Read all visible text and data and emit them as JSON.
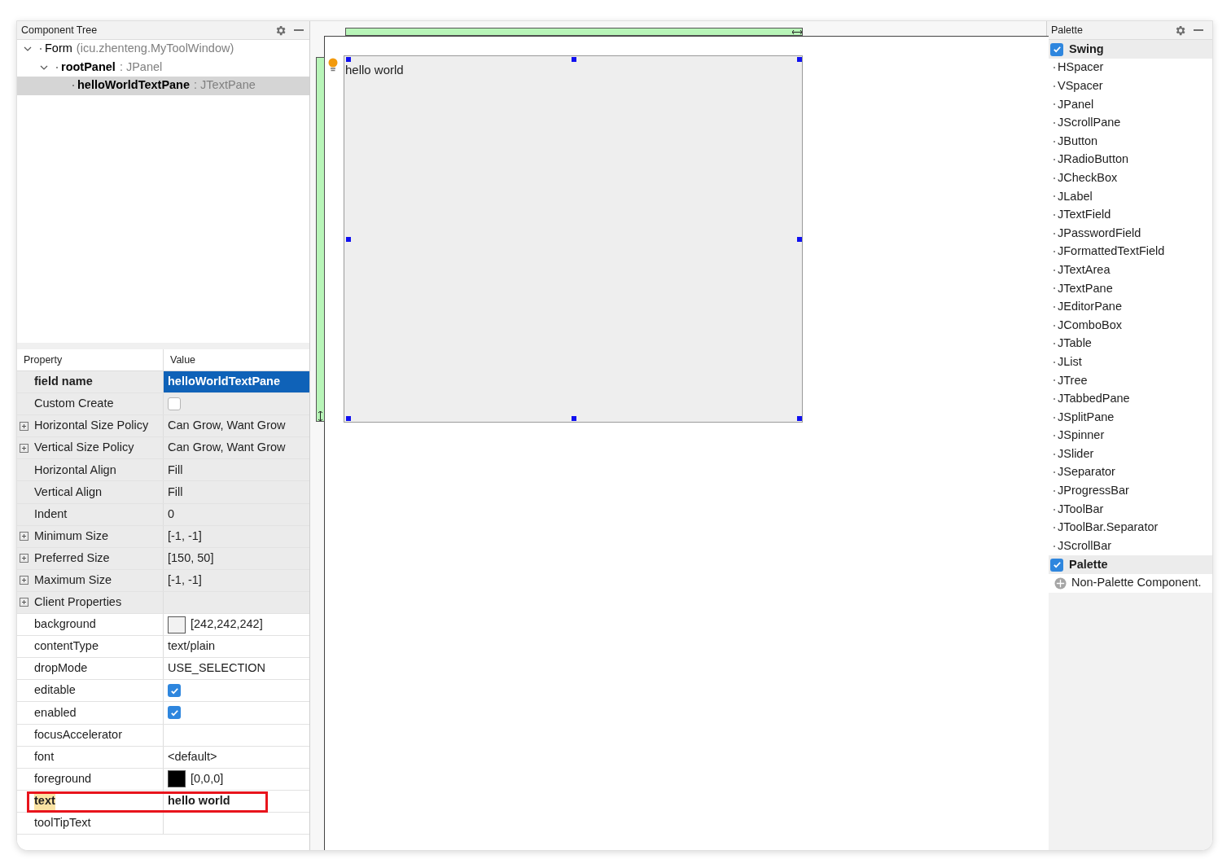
{
  "tree": {
    "title": "Component Tree",
    "items": [
      {
        "name": "Form",
        "type": "(icu.zhenteng.MyToolWindow)",
        "kind": "form",
        "expanded": true,
        "selected": false,
        "children": [
          {
            "name": "rootPanel",
            "type": ": JPanel",
            "kind": "component",
            "expanded": true,
            "selected": false,
            "children": [
              {
                "name": "helloWorldTextPane",
                "type": ": JTextPane",
                "kind": "component",
                "selected": true
              }
            ]
          }
        ]
      }
    ]
  },
  "properties": {
    "columns": [
      "Property",
      "Value"
    ],
    "rows": [
      {
        "name": "field name",
        "value": "helloWorldTextPane",
        "kind": "text",
        "selected": true
      },
      {
        "name": "Custom Create",
        "kind": "checkbox",
        "checked": false,
        "selected": false
      },
      {
        "name": "Horizontal Size Policy",
        "value": "Can Grow, Want Grow",
        "kind": "text",
        "expandable": true,
        "selected": false
      },
      {
        "name": "Vertical Size Policy",
        "value": "Can Grow, Want Grow",
        "kind": "text",
        "expandable": true,
        "selected": false
      },
      {
        "name": "Horizontal Align",
        "value": "Fill",
        "kind": "text",
        "selected": false
      },
      {
        "name": "Vertical Align",
        "value": "Fill",
        "kind": "text",
        "selected": false
      },
      {
        "name": "Indent",
        "value": "0",
        "kind": "text",
        "selected": false
      },
      {
        "name": "Minimum Size",
        "value": "[-1, -1]",
        "kind": "text",
        "expandable": true,
        "selected": false
      },
      {
        "name": "Preferred Size",
        "value": "[150, 50]",
        "kind": "text",
        "expandable": true,
        "selected": false
      },
      {
        "name": "Maximum Size",
        "value": "[-1, -1]",
        "kind": "text",
        "expandable": true,
        "selected": false
      },
      {
        "name": "Client Properties",
        "kind": "text",
        "expandable": true,
        "selected": false
      }
    ],
    "component_rows": [
      {
        "name": "background",
        "value": "[242,242,242]",
        "kind": "color",
        "color": "#f2f2f2",
        "selected": false
      },
      {
        "name": "contentType",
        "value": "text/plain",
        "kind": "text",
        "selected": false
      },
      {
        "name": "dropMode",
        "value": "USE_SELECTION",
        "kind": "text",
        "selected": false
      },
      {
        "name": "editable",
        "kind": "checkbox",
        "checked": true,
        "selected": false
      },
      {
        "name": "enabled",
        "kind": "checkbox",
        "checked": true,
        "selected": false
      },
      {
        "name": "focusAccelerator",
        "kind": "text",
        "selected": false
      },
      {
        "name": "font",
        "value": "<default>",
        "kind": "text",
        "selected": false
      },
      {
        "name": "foreground",
        "value": "[0,0,0]",
        "kind": "color",
        "color": "#000000",
        "selected": false
      },
      {
        "name": "text",
        "value": "hello world",
        "kind": "text",
        "selected": false,
        "modified": true,
        "highlighted": true
      },
      {
        "name": "toolTipText",
        "kind": "text",
        "selected": false
      }
    ]
  },
  "canvas": {
    "text_pane": {
      "text": "hello world",
      "selected": true
    }
  },
  "palette": {
    "title": "Palette",
    "groups": [
      {
        "name": "Swing",
        "checked": true,
        "items": [
          {
            "name": "HSpacer",
            "kind": "component"
          },
          {
            "name": "VSpacer",
            "kind": "component"
          },
          {
            "name": "JPanel",
            "kind": "component"
          },
          {
            "name": "JScrollPane",
            "kind": "component"
          },
          {
            "name": "JButton",
            "kind": "component"
          },
          {
            "name": "JRadioButton",
            "kind": "component"
          },
          {
            "name": "JCheckBox",
            "kind": "component"
          },
          {
            "name": "JLabel",
            "kind": "component"
          },
          {
            "name": "JTextField",
            "kind": "component"
          },
          {
            "name": "JPasswordField",
            "kind": "component"
          },
          {
            "name": "JFormattedTextField",
            "kind": "component"
          },
          {
            "name": "JTextArea",
            "kind": "component"
          },
          {
            "name": "JTextPane",
            "kind": "component"
          },
          {
            "name": "JEditorPane",
            "kind": "component"
          },
          {
            "name": "JComboBox",
            "kind": "component"
          },
          {
            "name": "JTable",
            "kind": "component"
          },
          {
            "name": "JList",
            "kind": "component"
          },
          {
            "name": "JTree",
            "kind": "component"
          },
          {
            "name": "JTabbedPane",
            "kind": "component"
          },
          {
            "name": "JSplitPane",
            "kind": "component"
          },
          {
            "name": "JSpinner",
            "kind": "component"
          },
          {
            "name": "JSlider",
            "kind": "component"
          },
          {
            "name": "JSeparator",
            "kind": "component"
          },
          {
            "name": "JProgressBar",
            "kind": "component"
          },
          {
            "name": "JToolBar",
            "kind": "component"
          },
          {
            "name": "JToolBar.Separator",
            "kind": "component"
          },
          {
            "name": "JScrollBar",
            "kind": "component"
          }
        ]
      },
      {
        "name": "Palette",
        "checked": true,
        "items": [
          {
            "name": "Non-Palette Component.",
            "kind": "special"
          }
        ]
      }
    ]
  }
}
